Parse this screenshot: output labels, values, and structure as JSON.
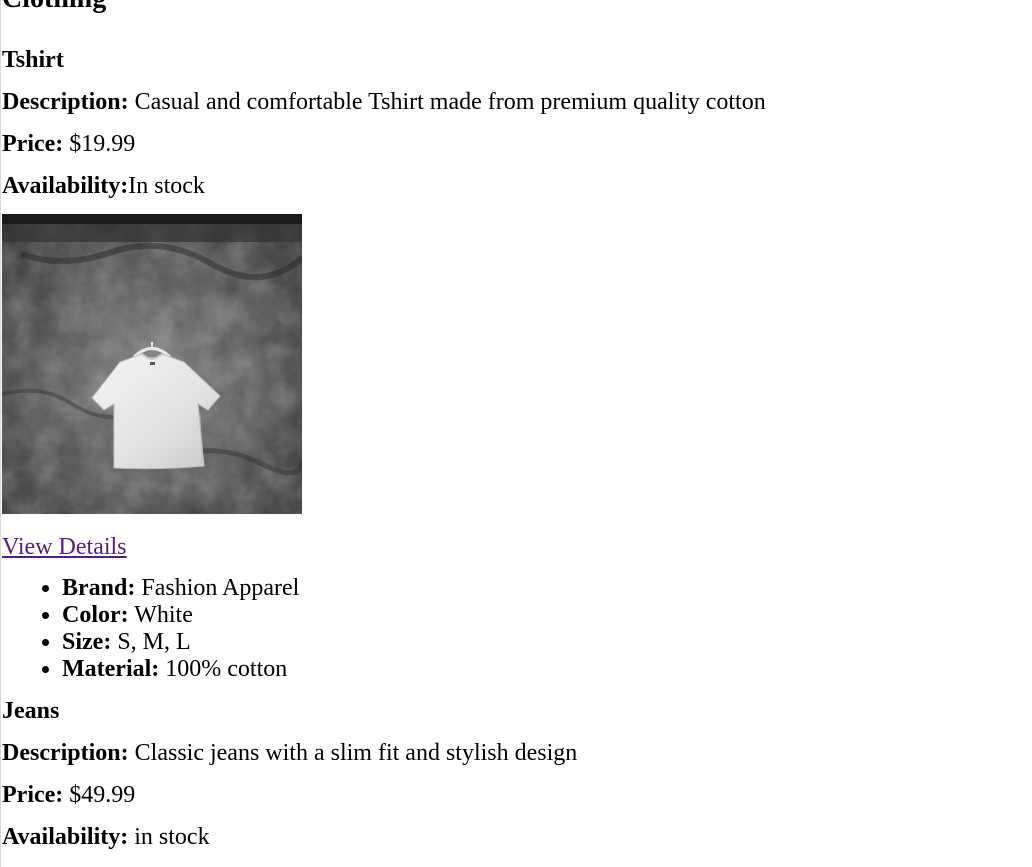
{
  "page": {
    "title": "Clothing"
  },
  "products": [
    {
      "name": "Tshirt",
      "description_label": "Description:",
      "description": "Casual and comfortable Tshirt made from premium quality cotton",
      "price_label": "Price:",
      "price": "$19.99",
      "availability_label": "Availability:",
      "availability": "In stock",
      "image_alt": "white tshirt on hanger",
      "link_text": "View Details",
      "specs": [
        {
          "label": "Brand:",
          "value": "Fashion Apparel"
        },
        {
          "label": "Color:",
          "value": "White"
        },
        {
          "label": "Size:",
          "value": "S, M, L"
        },
        {
          "label": "Material:",
          "value": "100% cotton"
        }
      ]
    },
    {
      "name": "Jeans",
      "description_label": "Description:",
      "description": "Classic jeans with a slim fit and stylish design",
      "price_label": "Price:",
      "price": "$49.99",
      "availability_label": "Availability:",
      "availability": "in stock"
    }
  ],
  "colors": {
    "link_visited": "#551a8b",
    "text": "#000000",
    "background": "#ffffff"
  }
}
